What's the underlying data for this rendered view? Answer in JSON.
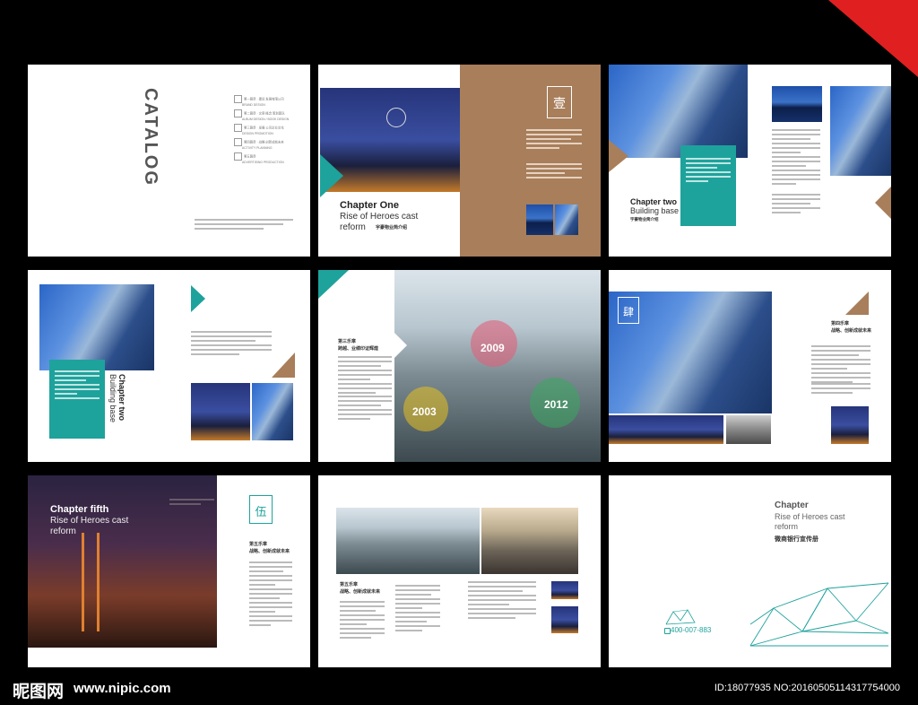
{
  "corner_accent_color": "#e02020",
  "colors": {
    "teal": "#1ea29c",
    "brown": "#a87e5b"
  },
  "spread1": {
    "catalog_title": "CATALOG",
    "items": [
      {
        "cn": "第一篇章 · 建设 发展有限公司",
        "en": "BRAND DESIGN"
      },
      {
        "cn": "第二篇章 · 文案 概念 策划团队",
        "en": "ALBUM DESIGN / BOOK DESIGN"
      },
      {
        "cn": "第三篇章 · 发展 公司企业文化",
        "en": "DESIGN PROMOTION"
      },
      {
        "cn": "第四篇章 · 战略 创新成就未来",
        "en": "ACTIVITY PLANNING"
      },
      {
        "cn": "第五篇章",
        "en": "ADVERTISING PRODUCTION"
      }
    ]
  },
  "spread2": {
    "chapter_title": "Chapter One",
    "chapter_sub1": "Rise of Heroes cast",
    "chapter_sub2": "reform",
    "chapter_cn": "宇豪物业简介绍",
    "seal_char": "壹"
  },
  "spread3": {
    "chapter_title": "Chapter two",
    "chapter_sub": "Building base",
    "chapter_cn": "宇豪物业简介绍"
  },
  "spread4": {
    "chapter_title": "Chapter two",
    "chapter_sub": "Building base"
  },
  "spread5": {
    "heading_cn1": "第三乐章",
    "heading_cn2": "跨越、业绩印证辉煌",
    "bubbles": [
      {
        "label": "2009",
        "color": "#e0607a"
      },
      {
        "label": "2003",
        "color": "#e8c020"
      },
      {
        "label": "2012",
        "color": "#3aa860"
      }
    ]
  },
  "spread6": {
    "seal_char": "肆",
    "heading_cn1": "第四乐章",
    "heading_cn2": "战略、创新成就未来"
  },
  "spread7": {
    "chapter_title": "Chapter fifth",
    "chapter_sub1": "Rise of Heroes cast",
    "chapter_sub2": "reform",
    "seal_char": "伍",
    "heading_cn1": "第五乐章",
    "heading_cn2": "战略、创新成就未来"
  },
  "spread8": {
    "heading_cn1": "第五乐章",
    "heading_cn2": "战略、创新成就未来"
  },
  "spread9": {
    "chapter_title": "Chapter",
    "chapter_sub1": "Rise of Heroes cast",
    "chapter_sub2": "reform",
    "chapter_cn": "微商银行宣传册",
    "phone": "400-007-883"
  },
  "watermark": {
    "logo": "昵图网",
    "site": "www.nipic.com",
    "id": "ID:18077935 NO:20160505114317754000"
  }
}
